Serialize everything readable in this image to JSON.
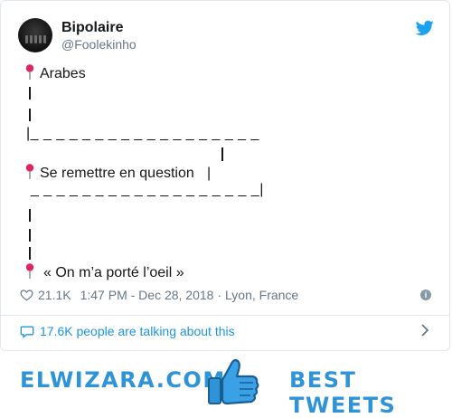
{
  "tweet": {
    "author_name": "Bipolaire",
    "author_handle": "@Foolekinho",
    "lines": {
      "l1": "Arabes",
      "l2": "Se remettre en question",
      "l3": "« On m’a porté l’oeil »",
      "dashes_a": "|_ _ _ _ _ _ _ _ _ _ _ _ _ _ _ _ _ _",
      "dashes_b": " _ _ _ _ _ _ _ _ _ _ _ _ _ _ _ _ _ _|",
      "bar_after_q": "|"
    },
    "likes": "21.1K",
    "timestamp": "1:47 PM - Dec 28, 2018",
    "location": "· Lyon, France"
  },
  "footer": {
    "talking": "17.6K people are talking about this"
  },
  "banner": {
    "left": "ELWIZARA.COM",
    "right": "BEST TWEETS"
  },
  "colors": {
    "brand_blue": "#2f93d8",
    "twitter_blue": "#1da1f2",
    "pin_red": "#e0245e"
  },
  "icons": [
    "avatar",
    "twitter-bird-icon",
    "pin-icon",
    "heart-icon",
    "info-icon",
    "speech-bubble-icon",
    "chevron-right-icon",
    "thumbs-up-icon"
  ]
}
